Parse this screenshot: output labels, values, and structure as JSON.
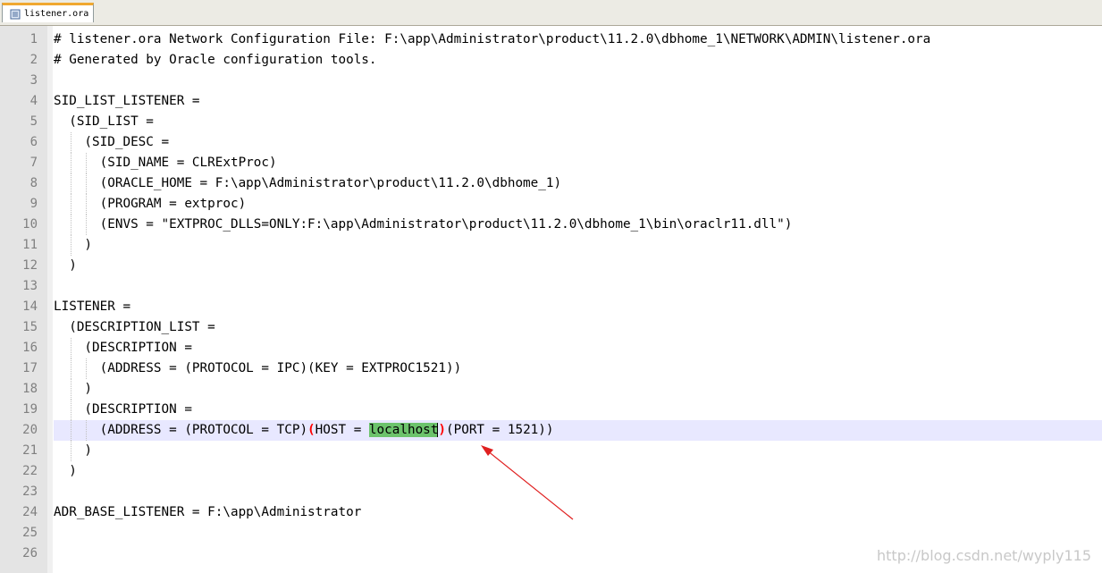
{
  "tab": {
    "label": "listener.ora",
    "icon": "document-icon"
  },
  "editor": {
    "lines": [
      {
        "n": "1",
        "text": "# listener.ora Network Configuration File: F:\\app\\Administrator\\product\\11.2.0\\dbhome_1\\NETWORK\\ADMIN\\listener.ora"
      },
      {
        "n": "2",
        "text": "# Generated by Oracle configuration tools."
      },
      {
        "n": "3",
        "text": ""
      },
      {
        "n": "4",
        "text": "SID_LIST_LISTENER ="
      },
      {
        "n": "5",
        "text": "  (SID_LIST ="
      },
      {
        "n": "6",
        "text": "    (SID_DESC ="
      },
      {
        "n": "7",
        "text": "      (SID_NAME = CLRExtProc)"
      },
      {
        "n": "8",
        "text": "      (ORACLE_HOME = F:\\app\\Administrator\\product\\11.2.0\\dbhome_1)"
      },
      {
        "n": "9",
        "text": "      (PROGRAM = extproc)"
      },
      {
        "n": "10",
        "text": "      (ENVS = \"EXTPROC_DLLS=ONLY:F:\\app\\Administrator\\product\\11.2.0\\dbhome_1\\bin\\oraclr11.dll\")"
      },
      {
        "n": "11",
        "text": "    )"
      },
      {
        "n": "12",
        "text": "  )"
      },
      {
        "n": "13",
        "text": ""
      },
      {
        "n": "14",
        "text": "LISTENER ="
      },
      {
        "n": "15",
        "text": "  (DESCRIPTION_LIST ="
      },
      {
        "n": "16",
        "text": "    (DESCRIPTION ="
      },
      {
        "n": "17",
        "text": "      (ADDRESS = (PROTOCOL = IPC)(KEY = EXTPROC1521))"
      },
      {
        "n": "18",
        "text": "    )"
      },
      {
        "n": "19",
        "text": "    (DESCRIPTION ="
      },
      {
        "n": "20",
        "text": ""
      },
      {
        "n": "21",
        "text": "    )"
      },
      {
        "n": "22",
        "text": "  )"
      },
      {
        "n": "23",
        "text": ""
      },
      {
        "n": "24",
        "text": "ADR_BASE_LISTENER = F:\\app\\Administrator"
      },
      {
        "n": "25",
        "text": ""
      },
      {
        "n": "26",
        "text": ""
      }
    ],
    "current_line": {
      "prefix": "      (ADDRESS = (PROTOCOL = TCP)",
      "open_brace": "(",
      "mid": "HOST = ",
      "selected": "localhost",
      "close_brace": ")",
      "suffix": "(PORT = 1521))"
    }
  },
  "watermark": "http://blog.csdn.net/wyply115",
  "colors": {
    "current_line_bg": "#e8e8ff",
    "selection_bg": "#6cc36c",
    "brace_highlight": "#ff0000",
    "arrow": "#e02020",
    "tab_accent": "#f0a830"
  }
}
